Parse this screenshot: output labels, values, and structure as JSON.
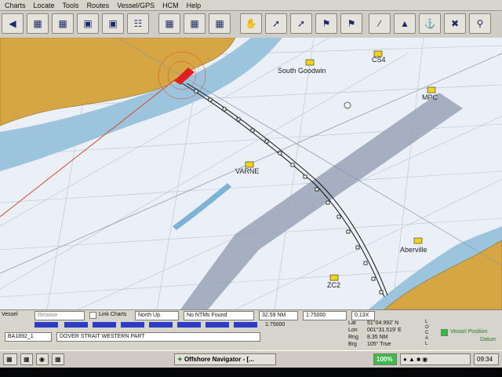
{
  "menu": [
    "Charts",
    "Locate",
    "Tools",
    "Routes",
    "Vessel/GPS",
    "HCM",
    "Help"
  ],
  "toolbar_icons": [
    "zoom-out-icon",
    "chart-select-icon",
    "chart-icon",
    "scale-icon",
    "scale-icon",
    "overlay-icon",
    "layers-icon",
    "chart-folder-icon",
    "display-icon",
    "hand-icon",
    "route-icon",
    "route-edit-icon",
    "goto-icon",
    "mark-icon",
    "measure-icon",
    "triangle-icon",
    "anchor-icon",
    "target-icon",
    "zoom-in-icon",
    "lookup-icon"
  ],
  "chart": {
    "place_labels": {
      "south_goodwin": "South Goodwin",
      "cs4": "CS4",
      "mpc": "MPC",
      "varne": "VARNE",
      "aberville": "Aberville",
      "zc2": "ZC2"
    }
  },
  "status": {
    "vessel_label": "Vessel",
    "vessel_dropdown": "Relative",
    "link_charts_label": "Link Charts",
    "orientation": "North Up",
    "ntms": "No NTMs Found",
    "range": "32.59 NM",
    "scale": "1:75000",
    "zoom": "0.13X",
    "scale_bar_label": "1:75000",
    "chart_id": "BA1892_1",
    "chart_name": "DOVER STRAIT WESTERN PART",
    "lat_label": "Lat",
    "lat_value": "51°04.992' N",
    "lon_label": "Lon",
    "lon_value": "001°31.519' E",
    "rng_label": "Rng",
    "rng_value": "8.35 NM",
    "brg_label": "Brg",
    "brg_value": "105° True",
    "mode_letters": "L O C A L",
    "vessel_position": "Vessel Position",
    "datum": "Datum"
  },
  "taskbar": {
    "app": "Offshore Navigator - [...",
    "zoom": "100%",
    "time": "09:34"
  },
  "colors": {
    "land": "#d6a645",
    "shallow": "#9cc4dc",
    "sea": "#eaf0f6",
    "lane": "#9aa2b8",
    "route": "#101010",
    "bearing": "#d44a2c",
    "vessel": "#e02020"
  }
}
